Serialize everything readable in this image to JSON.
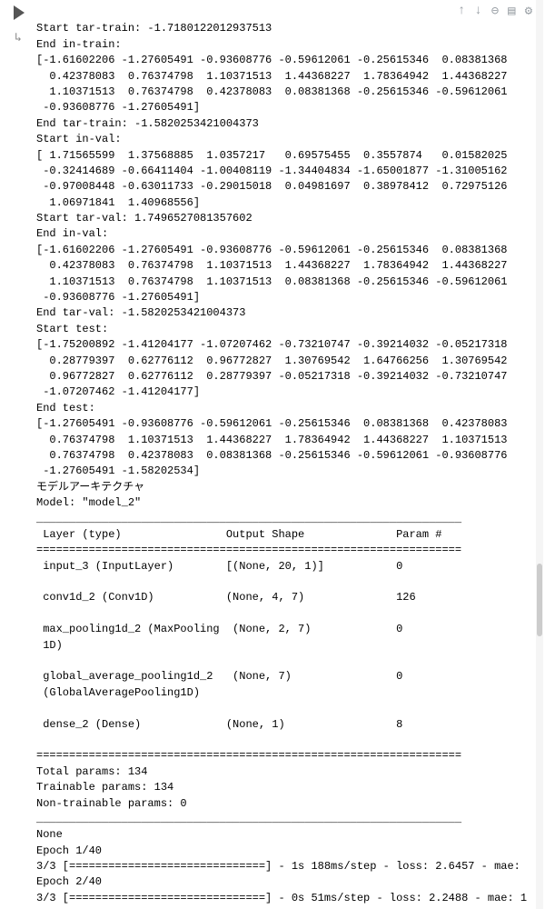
{
  "toolbar": {
    "up": "↑",
    "down": "↓",
    "link": "⊖",
    "comment": "▤",
    "gear": "⚙"
  },
  "output": {
    "line01": "Start tar-train: -1.7180122012937513",
    "line02": "End in-train:",
    "line03": "[-1.61602206 -1.27605491 -0.93608776 -0.59612061 -0.25615346  0.08381368",
    "line04": "  0.42378083  0.76374798  1.10371513  1.44368227  1.78364942  1.44368227",
    "line05": "  1.10371513  0.76374798  0.42378083  0.08381368 -0.25615346 -0.59612061",
    "line06": " -0.93608776 -1.27605491]",
    "line07": "End tar-train: -1.5820253421004373",
    "line08": "Start in-val:",
    "line09": "[ 1.71565599  1.37568885  1.0357217   0.69575455  0.3557874   0.01582025",
    "line10": " -0.32414689 -0.66411404 -1.00408119 -1.34404834 -1.65001877 -1.31005162",
    "line11": " -0.97008448 -0.63011733 -0.29015018  0.04981697  0.38978412  0.72975126",
    "line12": "  1.06971841  1.40968556]",
    "line13": "Start tar-val: 1.7496527081357602",
    "line14": "End in-val:",
    "line15": "[-1.61602206 -1.27605491 -0.93608776 -0.59612061 -0.25615346  0.08381368",
    "line16": "  0.42378083  0.76374798  1.10371513  1.44368227  1.78364942  1.44368227",
    "line17": "  1.10371513  0.76374798  1.10371513  0.08381368 -0.25615346 -0.59612061",
    "line18": " -0.93608776 -1.27605491]",
    "line19": "End tar-val: -1.5820253421004373",
    "line20": "Start test:",
    "line21": "[-1.75200892 -1.41204177 -1.07207462 -0.73210747 -0.39214032 -0.05217318",
    "line22": "  0.28779397  0.62776112  0.96772827  1.30769542  1.64766256  1.30769542",
    "line23": "  0.96772827  0.62776112  0.28779397 -0.05217318 -0.39214032 -0.73210747",
    "line24": " -1.07207462 -1.41204177]",
    "line25": "End test:",
    "line26": "[-1.27605491 -0.93608776 -0.59612061 -0.25615346  0.08381368  0.42378083",
    "line27": "  0.76374798  1.10371513  1.44368227  1.78364942  1.44368227  1.10371513",
    "line28": "  0.76374798  0.42378083  0.08381368 -0.25615346 -0.59612061 -0.93608776",
    "line29": " -1.27605491 -1.58202534]",
    "line30": "モデルアーキテクチャ",
    "line31": "Model: \"model_2\"",
    "line32": "_________________________________________________________________",
    "line33": " Layer (type)                Output Shape              Param #   ",
    "line34": "=================================================================",
    "line35": " input_3 (InputLayer)        [(None, 20, 1)]           0         ",
    "line36": "                                                                 ",
    "line37": " conv1d_2 (Conv1D)           (None, 4, 7)              126       ",
    "line38": "                                                                 ",
    "line39": " max_pooling1d_2 (MaxPooling  (None, 2, 7)             0         ",
    "line40": " 1D)                                                             ",
    "line41": "                                                                 ",
    "line42": " global_average_pooling1d_2   (None, 7)                0         ",
    "line43": " (GlobalAveragePooling1D)                                        ",
    "line44": "                                                                 ",
    "line45": " dense_2 (Dense)             (None, 1)                 8         ",
    "line46": "                                                                 ",
    "line47": "=================================================================",
    "line48": "Total params: 134",
    "line49": "Trainable params: 134",
    "line50": "Non-trainable params: 0",
    "line51": "_________________________________________________________________",
    "line52": "None",
    "line53": "Epoch 1/40",
    "line54": "3/3 [==============================] - 1s 188ms/step - loss: 2.6457 - mae: ",
    "line55": "Epoch 2/40",
    "line56": "3/3 [==============================] - 0s 51ms/step - loss: 2.2488 - mae: 1"
  }
}
